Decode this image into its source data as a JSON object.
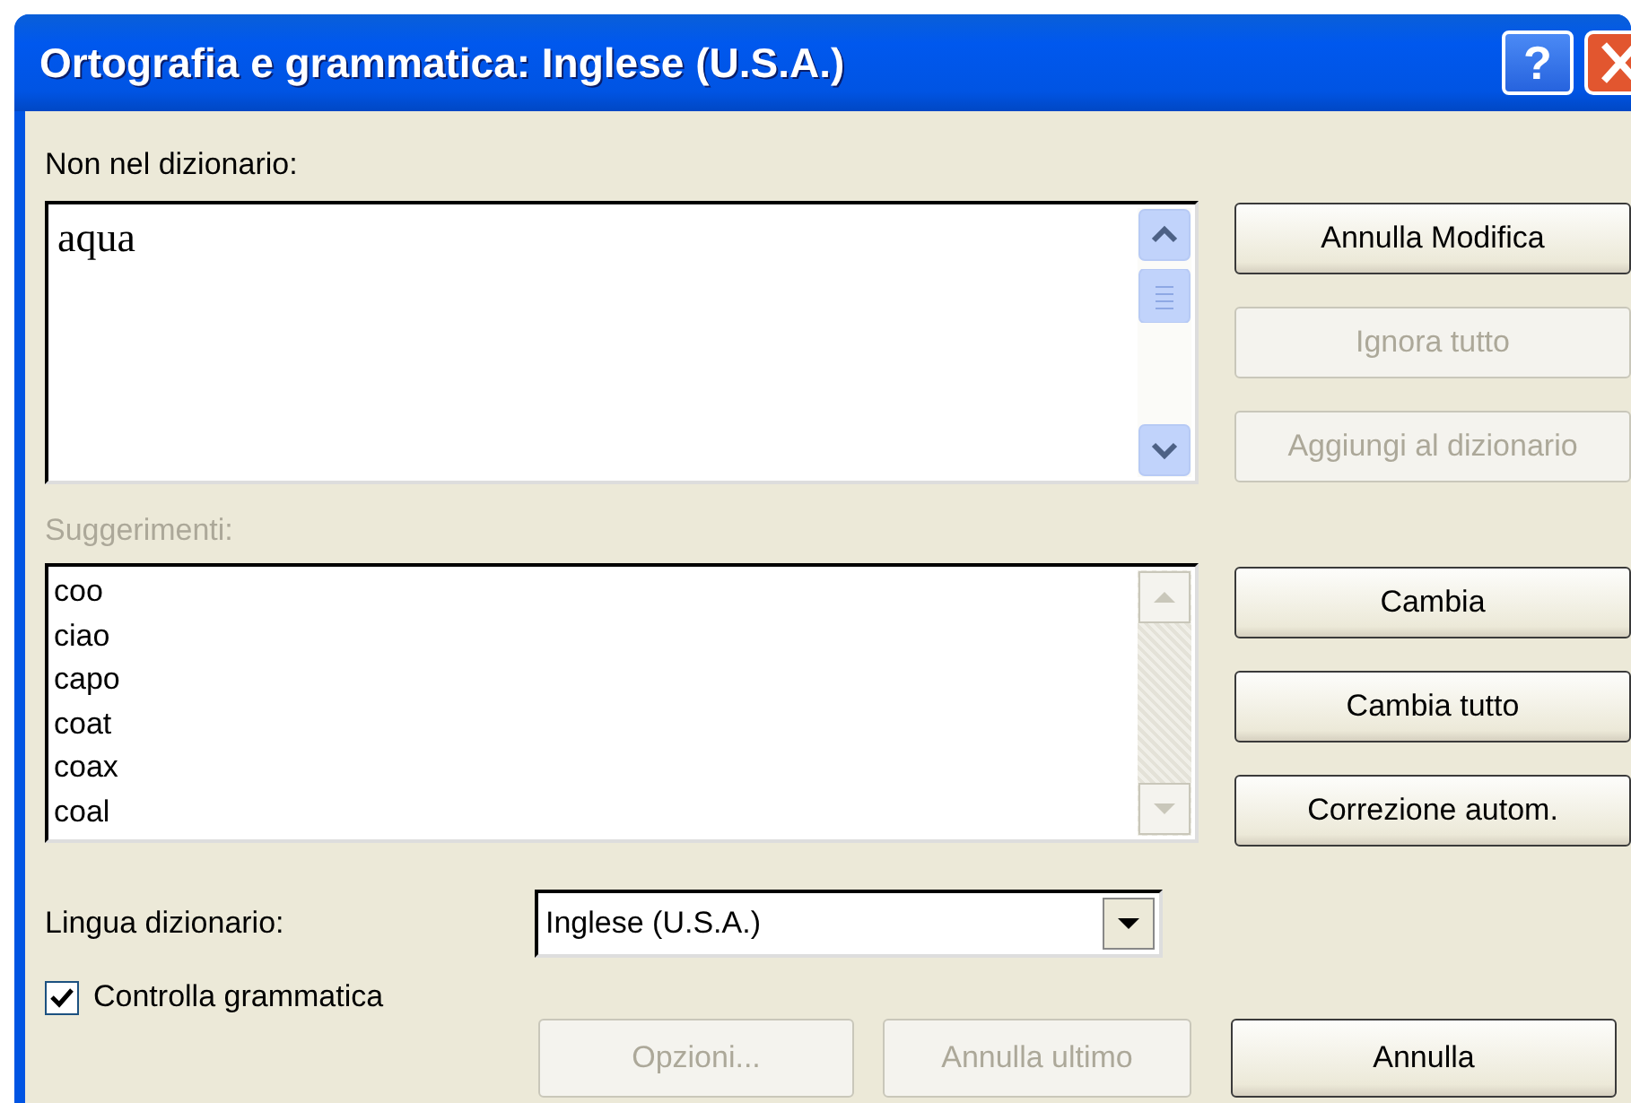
{
  "window": {
    "title": "Ortografia e grammatica: Inglese (U.S.A.)",
    "help_label": "?"
  },
  "not_in_dictionary": {
    "label": "Non nel dizionario:",
    "text": "aqua"
  },
  "side_buttons": [
    {
      "label": "Annulla Modifica",
      "disabled": false
    },
    {
      "label": "Ignora tutto",
      "disabled": true
    },
    {
      "label": "Aggiungi al dizionario",
      "disabled": true
    }
  ],
  "suggestions": {
    "label": "Suggerimenti:",
    "disabled": true,
    "items": [
      "coo",
      "ciao",
      "capo",
      "coat",
      "coax",
      "coal"
    ]
  },
  "suggestion_buttons": [
    {
      "label": "Cambia",
      "disabled": false
    },
    {
      "label": "Cambia tutto",
      "disabled": false
    },
    {
      "label": "Correzione autom.",
      "disabled": false
    }
  ],
  "dictionary_language": {
    "label": "Lingua dizionario:",
    "value": "Inglese (U.S.A.)"
  },
  "check_grammar": {
    "label": "Controlla grammatica",
    "checked": true
  },
  "bottom_buttons": [
    {
      "label": "Opzioni...",
      "disabled": true
    },
    {
      "label": "Annulla ultimo",
      "disabled": true
    },
    {
      "label": "Annulla",
      "disabled": false
    }
  ]
}
